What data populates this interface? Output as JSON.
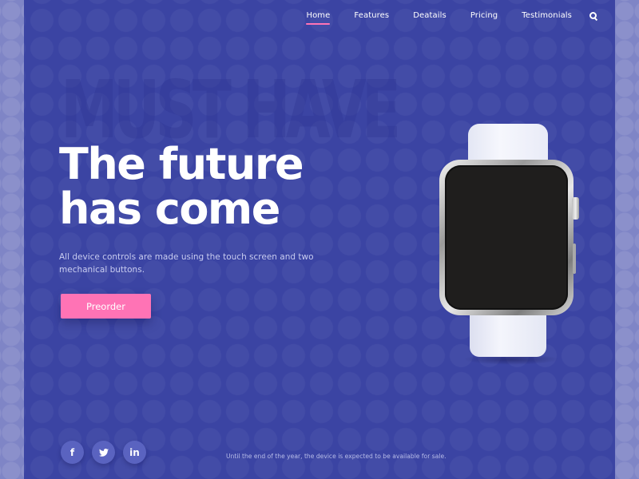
{
  "nav": {
    "items": [
      {
        "label": "Home",
        "active": true
      },
      {
        "label": "Features",
        "active": false
      },
      {
        "label": "Deatails",
        "active": false
      },
      {
        "label": "Pricing",
        "active": false
      },
      {
        "label": "Testimonials",
        "active": false
      }
    ],
    "search_icon": "search-icon"
  },
  "hero": {
    "background_word": "MUST HAVE",
    "headline_line1": "The future",
    "headline_line2": "has come",
    "description": "All device controls are made using the touch screen and two mechanical buttons.",
    "cta_label": "Preorder"
  },
  "product": {
    "image": "smartwatch-white-band"
  },
  "social": [
    {
      "name": "facebook",
      "glyph": "f"
    },
    {
      "name": "twitter",
      "glyph": "t"
    },
    {
      "name": "linkedin",
      "glyph": "in"
    }
  ],
  "footer": {
    "note": "Until the end of the year, the device is expected to be available for sale."
  },
  "colors": {
    "page_bg": "#3b44a3",
    "outer_bg": "#7f85c6",
    "accent": "#ff73b5",
    "social_bg": "#5a63c0"
  }
}
